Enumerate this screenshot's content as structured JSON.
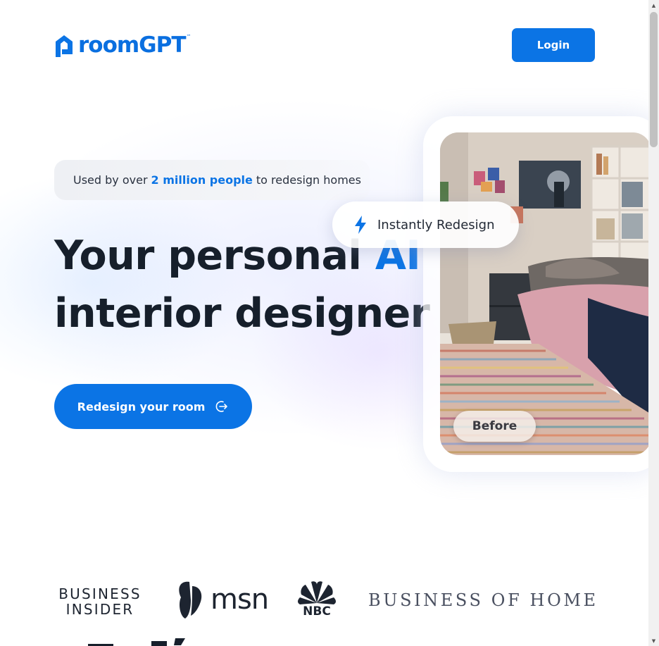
{
  "header": {
    "logo_text": "roomGPT",
    "logo_tm": "™",
    "login_label": "Login"
  },
  "badge": {
    "prefix": "Used by over",
    "highlight": "2 million people",
    "suffix": "to redesign homes"
  },
  "hero": {
    "headline_part1": "Your personal",
    "headline_ai": "AI",
    "headline_line2": "interior designer",
    "cta_label": "Redesign your room"
  },
  "preview": {
    "pill_label": "Instantly Redesign",
    "toggle_label": "Before"
  },
  "press": {
    "business_insider_line1": "BUSINESS",
    "business_insider_line2": "INSIDER",
    "msn": "msn",
    "nbc": "NBC",
    "business_of_home": "BUSINESS OF HOME"
  },
  "colors": {
    "brand": "#0b74e5",
    "text": "#161f2b"
  }
}
